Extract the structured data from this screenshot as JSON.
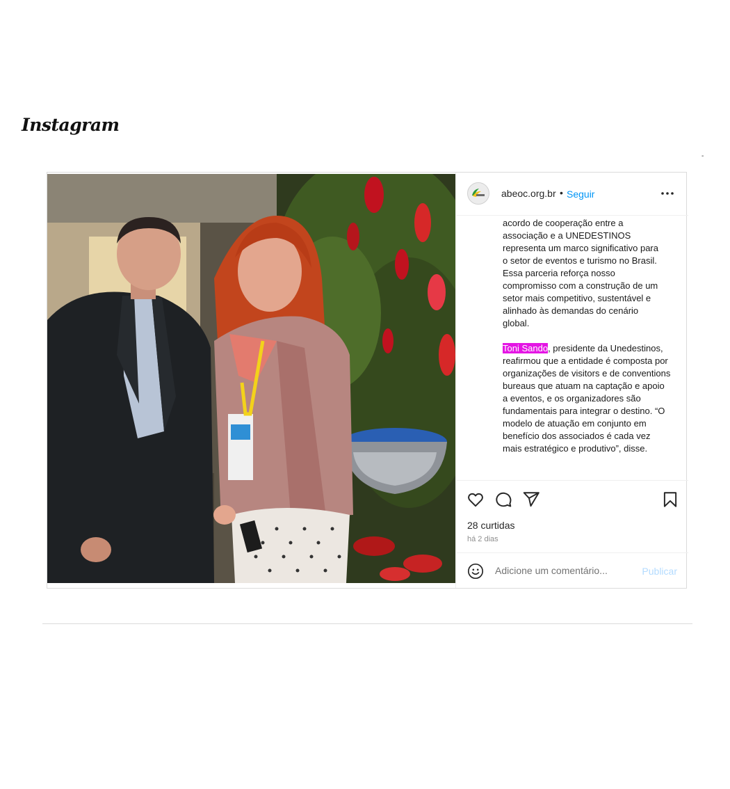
{
  "header": {
    "logo_text": "Instagram",
    "corner_mark": "-"
  },
  "post": {
    "author": {
      "username": "abeoc.org.br",
      "separator": "•",
      "follow_label": "Seguir",
      "more_icon": "more-horizontal-icon"
    },
    "caption": {
      "paragraph1": "acordo de cooperação entre a\nassociação e a UNEDESTINOS\nrepresenta um marco significativo para\no setor de eventos e turismo no Brasil.\nEssa parceria reforça nosso\ncompromisso com a construção de um\nsetor mais competitivo, sustentável e\nalinhado às demandas do cenário\nglobal.",
      "mention": "Toni Sando",
      "paragraph2_rest": ", presidente da Unedestinos, reafirmou que a entidade é composta por organizações de visitors e de conventions bureaus que atuam na captação e apoio a eventos, e os organizadores são fundamentais para integrar o destino. “O modelo de atuação em conjunto em benefício dos associados é cada vez mais estratégico e produtivo”, disse."
    },
    "actions": {
      "like_icon": "heart-icon",
      "comment_icon": "comment-icon",
      "share_icon": "send-icon",
      "save_icon": "bookmark-icon"
    },
    "likes_text": "28 curtidas",
    "time_text": "há 2 dias",
    "comment_box": {
      "emoji_icon": "emoji-icon",
      "placeholder": "Adicione um comentário...",
      "publish_label": "Publicar"
    }
  },
  "colors": {
    "link_blue": "#0095f6",
    "publish_disabled": "#b3dbff",
    "mention_highlight": "#e415e4",
    "border": "#dbdbdb"
  }
}
